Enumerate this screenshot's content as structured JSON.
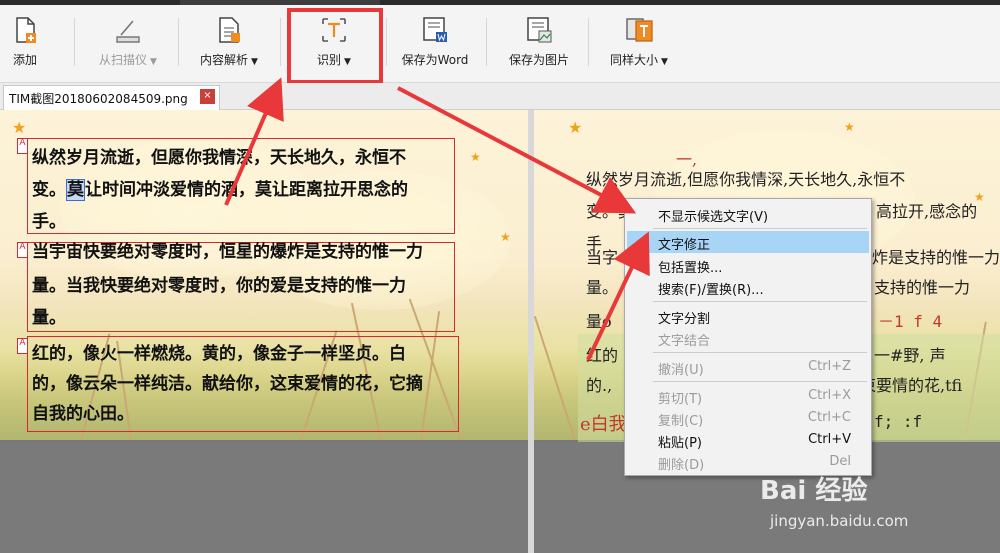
{
  "toolbar": {
    "buttons": [
      {
        "label": "添加",
        "icon": "add-document-icon",
        "disabled": false
      },
      {
        "label": "从扫描仪",
        "icon": "scanner-icon",
        "disabled": true,
        "caret": "▼"
      },
      {
        "label": "内容解析",
        "icon": "content-parse-icon",
        "disabled": false,
        "caret": "▼"
      },
      {
        "label": "识别",
        "icon": "text-recognize-icon",
        "disabled": false,
        "caret": "▼"
      },
      {
        "label": "保存为Word",
        "icon": "save-word-icon",
        "disabled": false
      },
      {
        "label": "保存为图片",
        "icon": "save-image-icon",
        "disabled": false
      },
      {
        "label": "同样大小",
        "icon": "same-size-icon",
        "disabled": false,
        "caret": "▼"
      }
    ]
  },
  "tab": {
    "title": "TIM截图20180602084509.png",
    "close": "×"
  },
  "source": {
    "blocks": [
      {
        "mark": "A",
        "lines": [
          "纵然岁月流逝，但愿你我情深，天长地久，永恒不",
          "变。莫让时间冲淡爱情的酒，莫让距离拉开思念的",
          "手。"
        ]
      },
      {
        "mark": "A",
        "lines": [
          "当宇宙快要绝对零度时，恒星的爆炸是支持的惟一力",
          "量。当我快要绝对零度时，你的爱是支持的惟一力",
          "量。"
        ]
      },
      {
        "mark": "A",
        "lines": [
          "红的，像火一样燃烧。黄的，像金子一样坚贞。白",
          "的，像云朵一样纯洁。献给你，这束爱情的花，它摘",
          "自我的心田。"
        ]
      }
    ],
    "highlight_char": "莫"
  },
  "result": {
    "lines": [
      "一,",
      "纵然岁月流逝,但愿你我情深,天长地久,永恒不",
      "变。莫",
      "高拉开,感念的",
      "手",
      "当字",
      "炸是支持的惟一力",
      "量。",
      "支持的惟一力",
      "量o",
      "－1 f 4",
      "红的",
      "一#野, 声",
      "的.,",
      "束要情的花,tfi",
      "e白我",
      "f; :f"
    ]
  },
  "context_menu": {
    "items": [
      {
        "label": "不显示候选文字(V)",
        "shortcut": "",
        "disabled": false,
        "selected": false
      },
      {
        "label": "文字修正",
        "shortcut": "",
        "disabled": false,
        "selected": true
      },
      {
        "label": "包括置换...",
        "shortcut": "",
        "disabled": false,
        "selected": false
      },
      {
        "label": "搜索(F)/置换(R)...",
        "shortcut": "",
        "disabled": false,
        "selected": false
      },
      {
        "label": "文字分割",
        "shortcut": "",
        "disabled": false,
        "selected": false
      },
      {
        "label": "文字结合",
        "shortcut": "",
        "disabled": true,
        "selected": false
      },
      {
        "label": "撤消(U)",
        "shortcut": "Ctrl+Z",
        "disabled": true,
        "selected": false
      },
      {
        "label": "剪切(T)",
        "shortcut": "Ctrl+X",
        "disabled": true,
        "selected": false
      },
      {
        "label": "复制(C)",
        "shortcut": "Ctrl+C",
        "disabled": true,
        "selected": false
      },
      {
        "label": "粘贴(P)",
        "shortcut": "Ctrl+V",
        "disabled": false,
        "selected": false
      },
      {
        "label": "删除(D)",
        "shortcut": "Del",
        "disabled": true,
        "selected": false
      }
    ]
  },
  "watermark": {
    "brand": "Bai 经验",
    "url": "jingyan.baidu.com"
  },
  "colors": {
    "annotation_red": "#e8383a",
    "menu_highlight": "#a8d4f5",
    "ocr_red": "#d9282f"
  }
}
